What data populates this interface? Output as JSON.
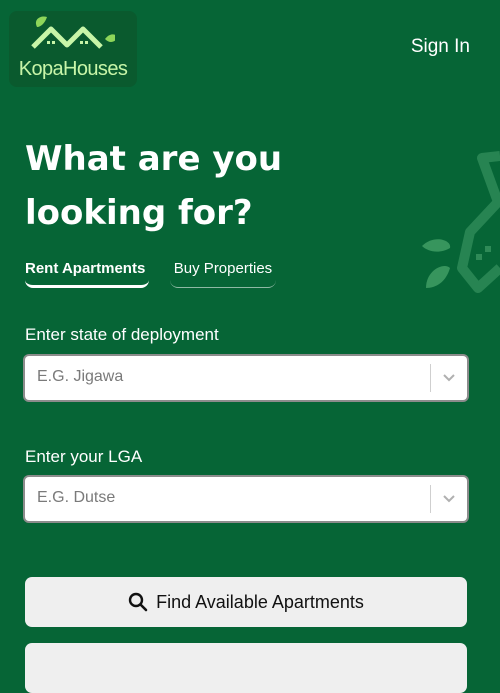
{
  "header": {
    "logo_text": "KopaHouses",
    "sign_in": "Sign In"
  },
  "hero": {
    "headline": "What are you looking for?"
  },
  "tabs": [
    {
      "label": "Rent Apartments",
      "active": true
    },
    {
      "label": "Buy Properties",
      "active": false
    }
  ],
  "form": {
    "state": {
      "label": "Enter state of deployment",
      "placeholder": "E.G. Jigawa"
    },
    "lga": {
      "label": "Enter your LGA",
      "placeholder": "E.G. Dutse"
    },
    "submit_label": "Find Available Apartments",
    "submit_icon": "search-icon"
  },
  "colors": {
    "background": "#066536",
    "logo_green": "#c8f5a8",
    "button_bg": "#efefef"
  }
}
